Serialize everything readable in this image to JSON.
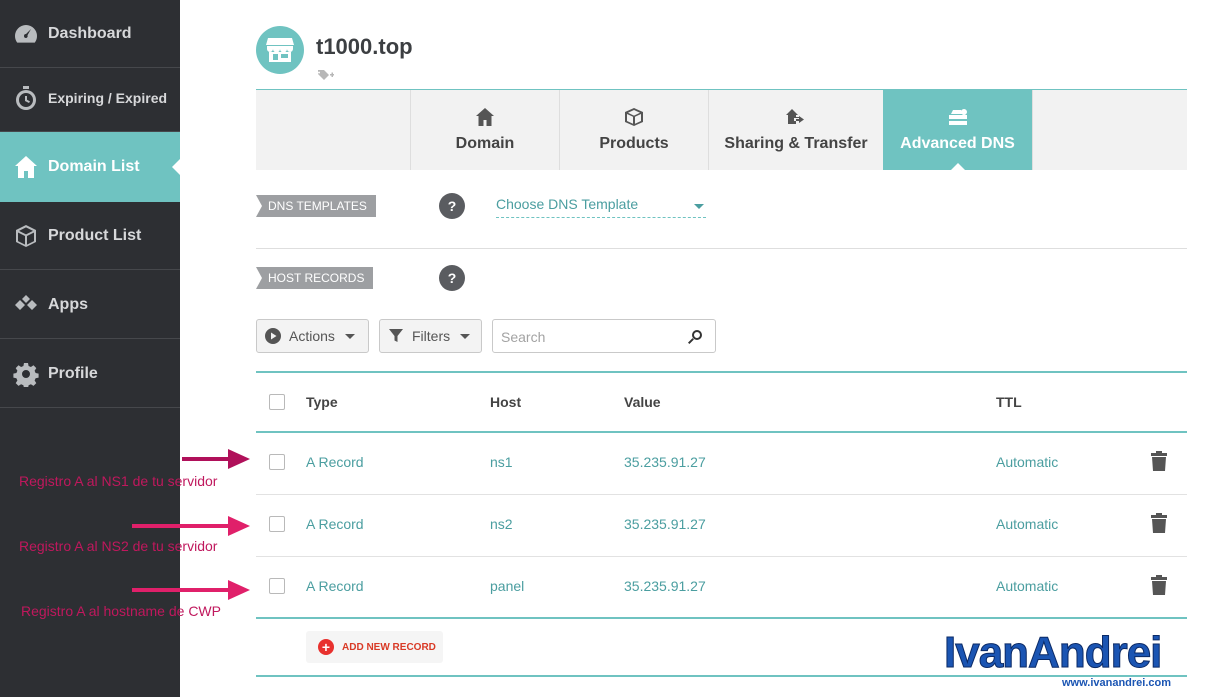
{
  "sidebar": {
    "items": [
      {
        "label": "Dashboard",
        "icon": "dashboard-gauge-icon"
      },
      {
        "label": "Expiring / Expired",
        "icon": "timer-icon"
      },
      {
        "label": "Domain List",
        "icon": "store-icon",
        "active": true
      },
      {
        "label": "Product List",
        "icon": "box-icon"
      },
      {
        "label": "Apps",
        "icon": "apps-icon"
      },
      {
        "label": "Profile",
        "icon": "gear-icon"
      }
    ]
  },
  "header": {
    "domain": "t1000.top",
    "avatar_icon": "store-icon",
    "tag_icon": "tag-add-icon"
  },
  "tabs": [
    {
      "label": "Domain",
      "icon": "home-icon"
    },
    {
      "label": "Products",
      "icon": "box-icon"
    },
    {
      "label": "Sharing & Transfer",
      "icon": "share-icon"
    },
    {
      "label": "Advanced DNS",
      "icon": "server-icon",
      "active": true
    }
  ],
  "dns_templates": {
    "label": "DNS TEMPLATES",
    "help": "?",
    "select_value": "Choose DNS Template"
  },
  "host_records": {
    "label": "HOST RECORDS",
    "help": "?"
  },
  "toolbar": {
    "actions_label": "Actions",
    "filters_label": "Filters",
    "search_placeholder": "Search"
  },
  "table": {
    "columns": {
      "type": "Type",
      "host": "Host",
      "value": "Value",
      "ttl": "TTL"
    },
    "rows": [
      {
        "type": "A Record",
        "host": "ns1",
        "value": "35.235.91.27",
        "ttl": "Automatic"
      },
      {
        "type": "A Record",
        "host": "ns2",
        "value": "35.235.91.27",
        "ttl": "Automatic"
      },
      {
        "type": "A Record",
        "host": "panel",
        "value": "35.235.91.27",
        "ttl": "Automatic"
      }
    ],
    "add_label": "ADD NEW RECORD"
  },
  "annotations": [
    "Registro A al NS1 de tu servidor",
    "Registro A al NS2 de tu servidor",
    "Registro A al hostname de CWP"
  ],
  "watermark": {
    "brand": "IvanAndrei",
    "url": "www.ivanandrei.com"
  },
  "colors": {
    "accent": "#6fc3c1",
    "sidebar": "#2d2f33",
    "annotation": "#c0185d",
    "danger": "#e8312e"
  }
}
